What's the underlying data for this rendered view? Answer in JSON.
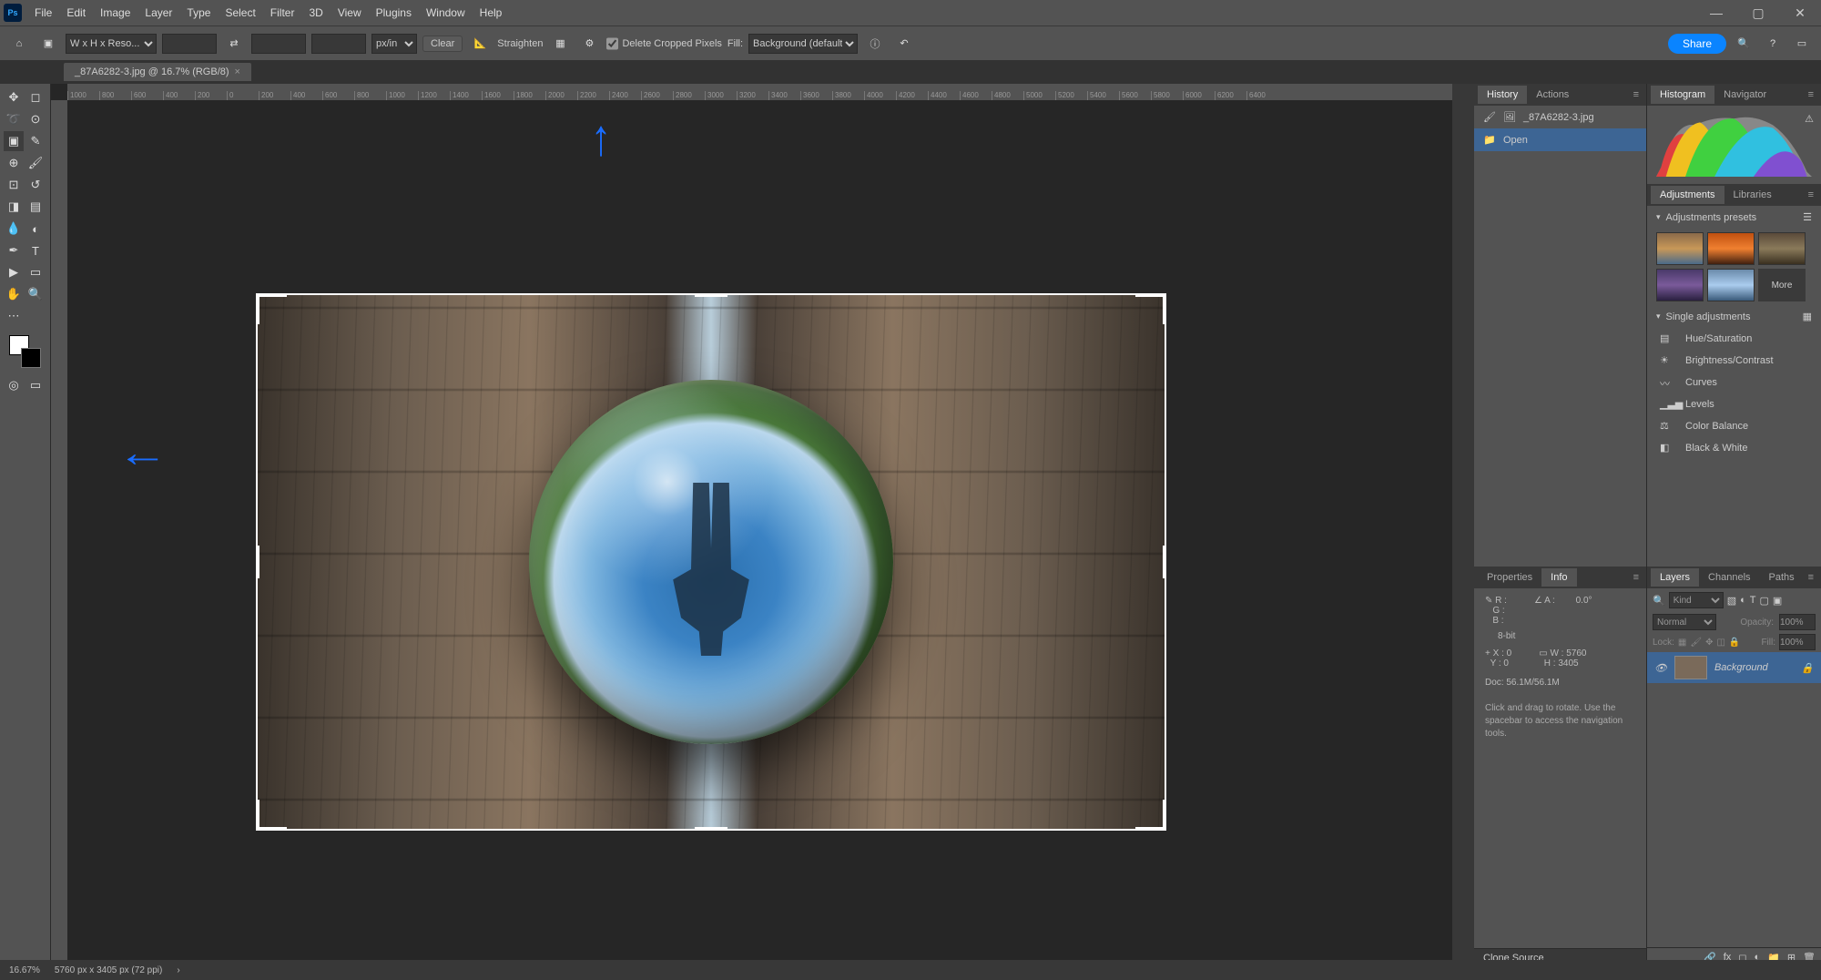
{
  "menu": {
    "items": [
      "File",
      "Edit",
      "Image",
      "Layer",
      "Type",
      "Select",
      "Filter",
      "3D",
      "View",
      "Plugins",
      "Window",
      "Help"
    ]
  },
  "options": {
    "preset": "W x H x Reso...",
    "unit": "px/in",
    "clear": "Clear",
    "straighten": "Straighten",
    "delete_cropped": "Delete Cropped Pixels",
    "fill_label": "Fill:",
    "fill_value": "Background (default)",
    "share": "Share"
  },
  "tab": {
    "title": "_87A6282-3.jpg @ 16.7% (RGB/8)"
  },
  "ruler_marks": [
    "1000",
    "800",
    "600",
    "400",
    "200",
    "0",
    "200",
    "400",
    "600",
    "800",
    "1000",
    "1200",
    "1400",
    "1600",
    "1800",
    "2000",
    "2200",
    "2400",
    "2600",
    "2800",
    "3000",
    "3200",
    "3400",
    "3600",
    "3800",
    "4000",
    "4200",
    "4400",
    "4600",
    "4800",
    "5000",
    "5200",
    "5400",
    "5600",
    "5800",
    "6000",
    "6200",
    "6400"
  ],
  "history": {
    "tab_history": "History",
    "tab_actions": "Actions",
    "file": "_87A6282-3.jpg",
    "step1": "Open"
  },
  "histogram": {
    "tab_histogram": "Histogram",
    "tab_navigator": "Navigator"
  },
  "adjustments": {
    "tab_adjustments": "Adjustments",
    "tab_libraries": "Libraries",
    "presets_hdr": "Adjustments presets",
    "more": "More",
    "single_hdr": "Single adjustments",
    "items": [
      "Hue/Saturation",
      "Brightness/Contrast",
      "Curves",
      "Levels",
      "Color Balance",
      "Black & White"
    ]
  },
  "layers": {
    "tab_layers": "Layers",
    "tab_channels": "Channels",
    "tab_paths": "Paths",
    "kind": "Kind",
    "blend": "Normal",
    "opacity_lbl": "Opacity:",
    "opacity": "100%",
    "lock_lbl": "Lock:",
    "fill_lbl": "Fill:",
    "fill": "100%",
    "layer_name": "Background"
  },
  "props": {
    "tab_properties": "Properties",
    "tab_info": "Info",
    "r": "R :",
    "g": "G :",
    "b": "B :",
    "a_lbl": "A :",
    "a_val": "0.0°",
    "depth": "8-bit",
    "x_lbl": "X :",
    "x": "0",
    "y_lbl": "Y :",
    "y": "0",
    "w_lbl": "W :",
    "w": "5760",
    "h_lbl": "H :",
    "h": "3405",
    "doc": "Doc: 56.1M/56.1M",
    "hint": "Click and drag to rotate. Use the spacebar to access the navigation tools."
  },
  "clone": {
    "title": "Clone Source"
  },
  "status": {
    "zoom": "16.67%",
    "dims": "5760 px x 3405 px (72 ppi)"
  }
}
